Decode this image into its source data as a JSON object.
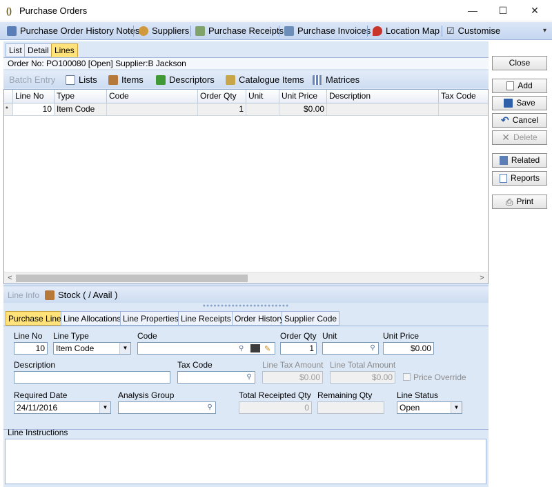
{
  "window": {
    "title": "Purchase Orders",
    "minimize": "—",
    "maximize": "☐",
    "close": "✕"
  },
  "toolbar": {
    "items": [
      {
        "label": "Purchase Order History Notes",
        "icon": "notes-icon"
      },
      {
        "label": "Suppliers",
        "icon": "person-icon"
      },
      {
        "label": "Purchase Receipts",
        "icon": "receipt-icon"
      },
      {
        "label": "Purchase Invoices",
        "icon": "invoice-icon"
      },
      {
        "label": "Location Map",
        "icon": "pin-icon"
      },
      {
        "label": "Customise",
        "icon": "checkbox-icon"
      }
    ],
    "overflow": "▾"
  },
  "top_tabs": [
    "List",
    "Detail",
    "Lines"
  ],
  "active_top_tab": "Lines",
  "order_info": "Order No: PO100080 [Open] Supplier:B Jackson",
  "grid_tools": {
    "batch_entry": "Batch Entry",
    "lists": "Lists",
    "items": "Items",
    "descriptors": "Descriptors",
    "catalogue_items": "Catalogue Items",
    "matrices": "Matrices"
  },
  "grid": {
    "columns": [
      "Line No",
      "Type",
      "Code",
      "Order Qty",
      "Unit",
      "Unit Price",
      "Description",
      "Tax Code"
    ],
    "rows": [
      {
        "marker": "*",
        "line_no": "10",
        "type": "Item Code",
        "code": "",
        "order_qty": "1",
        "unit": "",
        "unit_price": "$0.00",
        "description": "",
        "tax_code": ""
      }
    ],
    "scroll_left": "<",
    "scroll_right": ">"
  },
  "info_bar": {
    "line_info": "Line Info",
    "stock": "Stock ( / Avail )"
  },
  "detail_tabs": [
    "Purchase Line",
    "Line Allocations",
    "Line Properties",
    "Line Receipts",
    "Order History",
    "Supplier Code"
  ],
  "active_detail_tab": "Purchase Line",
  "form": {
    "line_no": {
      "label": "Line No",
      "value": "10"
    },
    "line_type": {
      "label": "Line Type",
      "value": "Item Code"
    },
    "code": {
      "label": "Code",
      "value": ""
    },
    "order_qty": {
      "label": "Order Qty",
      "value": "1"
    },
    "unit": {
      "label": "Unit",
      "value": ""
    },
    "unit_price": {
      "label": "Unit Price",
      "value": "$0.00"
    },
    "description": {
      "label": "Description",
      "value": ""
    },
    "tax_code": {
      "label": "Tax Code",
      "value": ""
    },
    "line_tax_amount": {
      "label": "Line Tax Amount",
      "value": "$0.00"
    },
    "line_total_amount": {
      "label": "Line Total Amount",
      "value": "$0.00"
    },
    "price_override": {
      "label": "Price Override",
      "checked": false
    },
    "required_date": {
      "label": "Required Date",
      "value": "24/11/2016"
    },
    "analysis_group": {
      "label": "Analysis Group",
      "value": ""
    },
    "total_receipted_qty": {
      "label": "Total Receipted Qty",
      "value": "0"
    },
    "remaining_qty": {
      "label": "Remaining Qty",
      "value": ""
    },
    "line_status": {
      "label": "Line Status",
      "value": "Open"
    }
  },
  "line_instructions": {
    "label": "Line Instructions",
    "value": ""
  },
  "side_buttons": {
    "close": "Close",
    "add": "Add",
    "save": "Save",
    "cancel": "Cancel",
    "delete": "Delete",
    "related": "Related",
    "reports": "Reports",
    "print": "Print"
  },
  "colors": {
    "accent_tab": "#ffe27a",
    "panel": "#dde8f7",
    "toolbar": "#c5d6f0"
  }
}
